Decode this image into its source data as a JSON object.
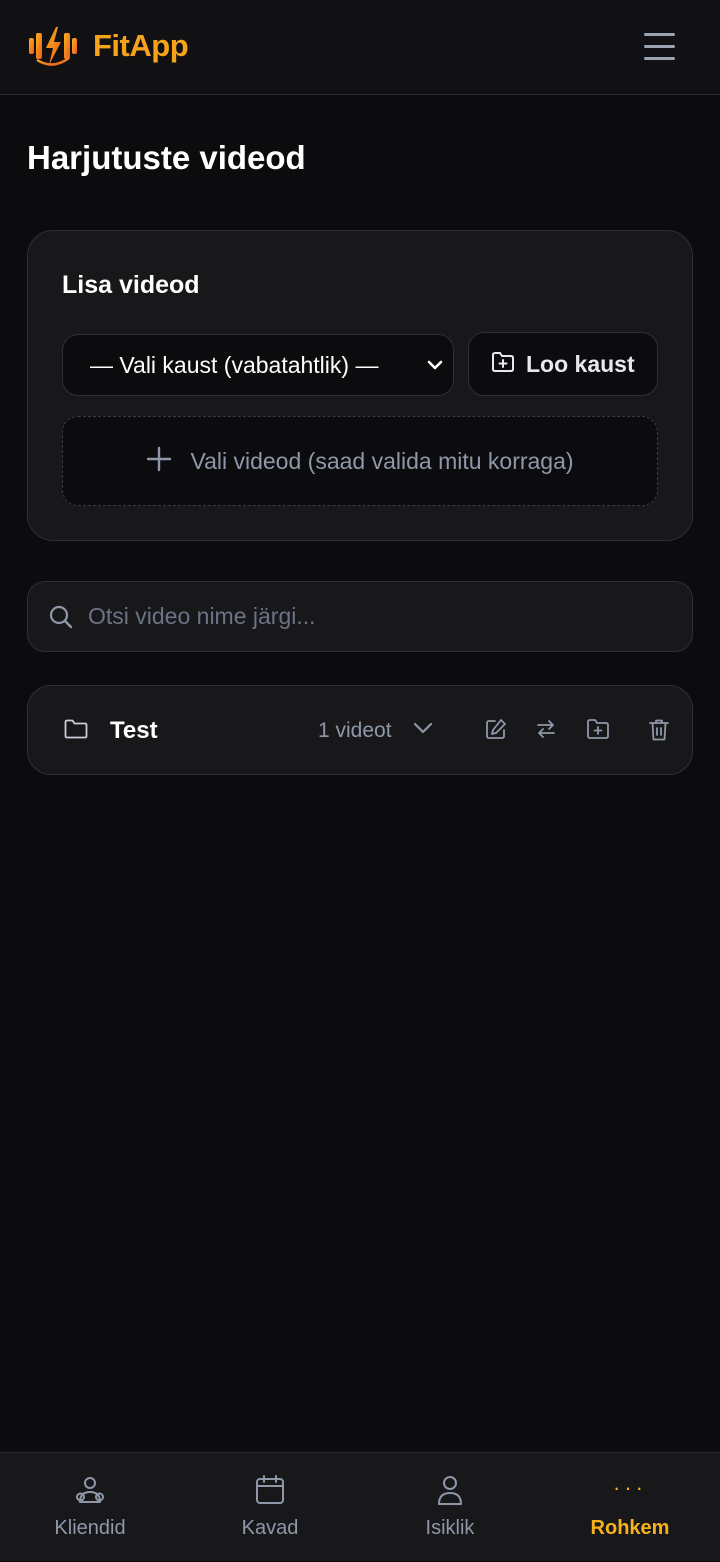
{
  "app": {
    "name": "FitApp",
    "logo_icon": "barbell-lightning-icon"
  },
  "header": {
    "menu_icon": "hamburger-menu-icon"
  },
  "page": {
    "title": "Harjutuste videod"
  },
  "add_videos": {
    "title": "Lisa videod",
    "folder_select": {
      "selected": "— Vali kaust (vabatahtlik) —",
      "options": [
        "— Vali kaust (vabatahtlik) —"
      ]
    },
    "create_folder_label": "Loo kaust",
    "pick_videos_label": "Vali videod (saad valida mitu korraga)"
  },
  "search": {
    "placeholder": "Otsi video nime järgi...",
    "value": ""
  },
  "folders": [
    {
      "name": "Test",
      "count_label": "1 videot",
      "actions": [
        "edit-icon",
        "move-icon",
        "add-to-folder-icon",
        "trash-icon"
      ]
    }
  ],
  "bottom_nav": {
    "items": [
      {
        "label": "Kliendid",
        "icon": "clients-icon",
        "active": false
      },
      {
        "label": "Kavad",
        "icon": "calendar-icon",
        "active": false
      },
      {
        "label": "Isiklik",
        "icon": "user-icon",
        "active": false
      },
      {
        "label": "Rohkem",
        "icon": "more-dots-icon",
        "active": true
      }
    ]
  },
  "colors": {
    "accent": "#f7a21b",
    "background": "#0c0c0e",
    "card": "#18181b",
    "muted": "#8f98a8"
  }
}
